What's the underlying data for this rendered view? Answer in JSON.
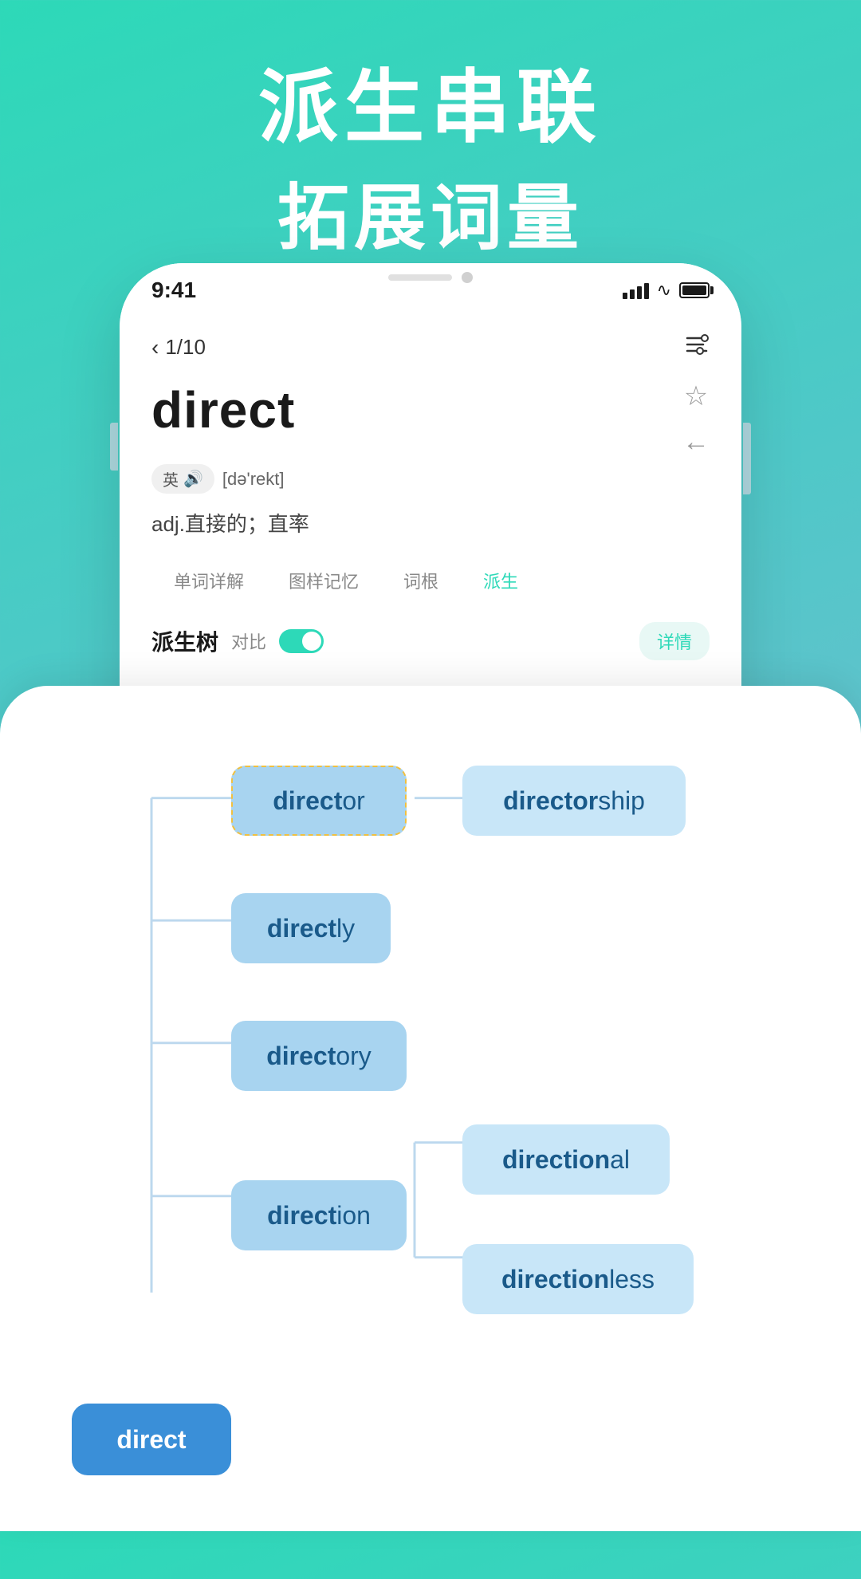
{
  "header": {
    "line1": "派生串联",
    "line2": "拓展词量"
  },
  "phone": {
    "time": "9:41",
    "nav": {
      "progress": "1/10",
      "settings_icon": "⊟"
    },
    "word": {
      "text": "direct",
      "pronunciation_lang": "英",
      "phonetic": "[də'rekt]",
      "definition": "adj.直接的；直率",
      "star_icon": "☆",
      "back_icon": "←"
    },
    "tabs": [
      {
        "label": "单词详解",
        "active": false
      },
      {
        "label": "图样记忆",
        "active": false
      },
      {
        "label": "词根",
        "active": false
      },
      {
        "label": "派生",
        "active": true
      }
    ],
    "derivation": {
      "title": "派生树",
      "compare_label": "对比",
      "detail_label": "详情"
    }
  },
  "tree": {
    "nodes": [
      {
        "id": "direct",
        "base": "direct",
        "suffix": "",
        "label": "direct"
      },
      {
        "id": "director",
        "base": "direct",
        "suffix": "or",
        "label": "director"
      },
      {
        "id": "directorship",
        "base": "director",
        "suffix": "ship",
        "label": "directorship"
      },
      {
        "id": "directly",
        "base": "direct",
        "suffix": "ly",
        "label": "directly"
      },
      {
        "id": "directory",
        "base": "direct",
        "suffix": "ory",
        "label": "directory"
      },
      {
        "id": "direction",
        "base": "direct",
        "suffix": "ion",
        "label": "direction"
      },
      {
        "id": "directional",
        "base": "direction",
        "suffix": "al",
        "label": "directional"
      },
      {
        "id": "directionless",
        "base": "direction",
        "suffix": "less",
        "label": "directionless"
      }
    ]
  }
}
